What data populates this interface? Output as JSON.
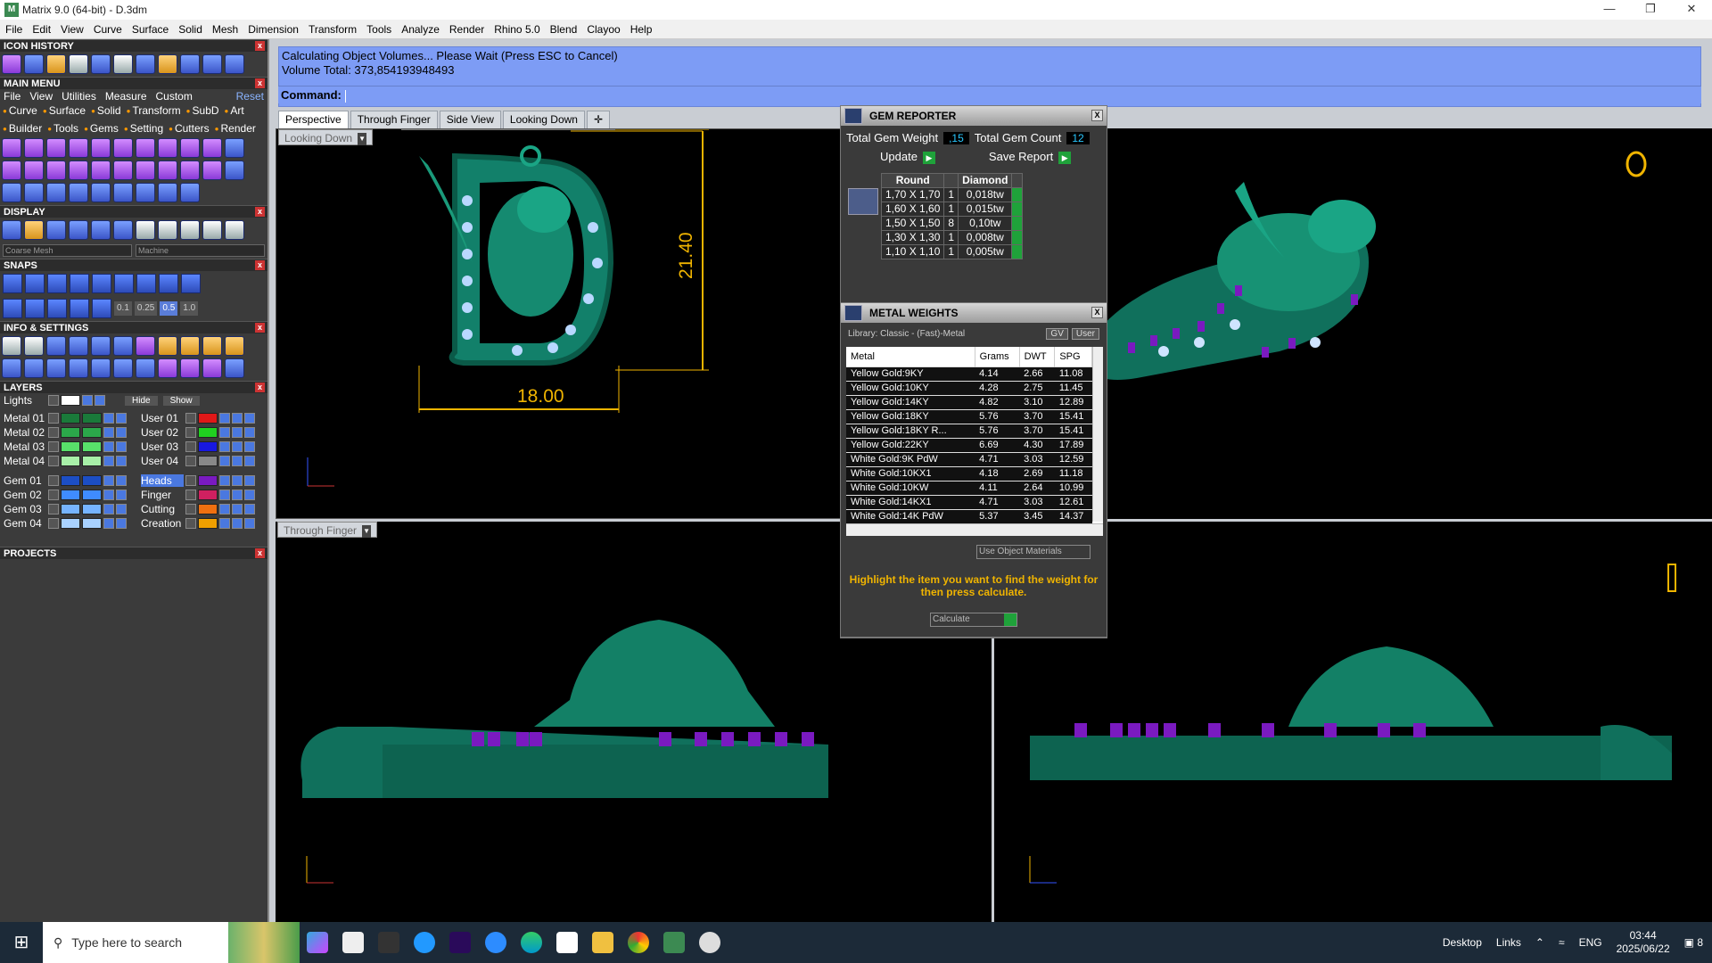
{
  "window": {
    "title": "Matrix 9.0 (64-bit) - D.3dm"
  },
  "menubar": [
    "File",
    "Edit",
    "View",
    "Curve",
    "Surface",
    "Solid",
    "Mesh",
    "Dimension",
    "Transform",
    "Tools",
    "Analyze",
    "Render",
    "Rhino 5.0",
    "Blend",
    "Clayoo",
    "Help"
  ],
  "left_panel": {
    "icon_history": "ICON HISTORY",
    "main_menu": "MAIN MENU",
    "main_menu_items": [
      "File",
      "View",
      "Utilities",
      "Measure",
      "Custom"
    ],
    "reset": "Reset",
    "categories": [
      "Curve",
      "Surface",
      "Solid",
      "Transform",
      "SubD",
      "Art",
      "Builder",
      "Tools",
      "Gems",
      "Setting",
      "Cutters",
      "Render"
    ],
    "display": "DISPLAY",
    "mesh_select": "Coarse Mesh",
    "material_select": "Machine",
    "snaps": "SNAPS",
    "snap_values": [
      "0.1",
      "0.25",
      "0.5",
      "1.0"
    ],
    "info_settings": "INFO & SETTINGS",
    "layers": "LAYERS",
    "lights": "Lights",
    "hide": "Hide",
    "show": "Show",
    "layers_left": [
      {
        "name": "Metal 01",
        "color": "#1a7a3a"
      },
      {
        "name": "Metal 02",
        "color": "#2ba84a"
      },
      {
        "name": "Metal 03",
        "color": "#58e06a"
      },
      {
        "name": "Metal 04",
        "color": "#a8f0a8"
      },
      {
        "name": "Gem 01",
        "color": "#1c4ec4"
      },
      {
        "name": "Gem 02",
        "color": "#3f8cff"
      },
      {
        "name": "Gem 03",
        "color": "#76b4ff"
      },
      {
        "name": "Gem 04",
        "color": "#a9d2ff"
      }
    ],
    "layers_right": [
      {
        "name": "User 01",
        "color": "#e01818"
      },
      {
        "name": "User 02",
        "color": "#20d020"
      },
      {
        "name": "User 03",
        "color": "#1818e0"
      },
      {
        "name": "User 04",
        "color": "#888888"
      },
      {
        "name": "Heads",
        "color": "#7a1ac0"
      },
      {
        "name": "Finger",
        "color": "#d02060"
      },
      {
        "name": "Cutting",
        "color": "#f07010"
      },
      {
        "name": "Creation",
        "color": "#f0a000"
      }
    ],
    "projects": "PROJECTS"
  },
  "command": {
    "line1": "Calculating Object Volumes... Please Wait (Press ESC to Cancel)",
    "line2": "Volume Total: 373,854193948493",
    "prompt": "Command:"
  },
  "tabs": [
    "Perspective",
    "Through Finger",
    "Side View",
    "Looking Down"
  ],
  "viewports": {
    "top_left_label": "Looking Down",
    "bottom_left_label": "Through Finger",
    "dim_width": "18.00",
    "dim_height": "21.40"
  },
  "gem_reporter": {
    "title": "GEM REPORTER",
    "total_weight_label": "Total Gem Weight",
    "total_weight": ",15",
    "total_count_label": "Total Gem Count",
    "total_count": "12",
    "update": "Update",
    "save_report": "Save Report",
    "headers": [
      "Round",
      "",
      "Diamond"
    ],
    "rows": [
      [
        "1,70 X 1,70",
        "1",
        "0,018tw"
      ],
      [
        "1,60 X 1,60",
        "1",
        "0,015tw"
      ],
      [
        "1,50 X 1,50",
        "8",
        "0,10tw"
      ],
      [
        "1,30 X 1,30",
        "1",
        "0,008tw"
      ],
      [
        "1,10 X 1,10",
        "1",
        "0,005tw"
      ]
    ]
  },
  "metal_weights": {
    "title": "METAL WEIGHTS",
    "library": "Library: Classic - (Fast)-Metal",
    "gv": "GV",
    "user": "User",
    "headers": [
      "Metal",
      "Grams",
      "DWT",
      "SPG"
    ],
    "rows": [
      [
        "Yellow Gold:9KY",
        "4.14",
        "2.66",
        "11.08"
      ],
      [
        "Yellow Gold:10KY",
        "4.28",
        "2.75",
        "11.45"
      ],
      [
        "Yellow Gold:14KY",
        "4.82",
        "3.10",
        "12.89"
      ],
      [
        "Yellow Gold:18KY",
        "5.76",
        "3.70",
        "15.41"
      ],
      [
        "Yellow Gold:18KY R...",
        "5.76",
        "3.70",
        "15.41"
      ],
      [
        "Yellow Gold:22KY",
        "6.69",
        "4.30",
        "17.89"
      ],
      [
        "White Gold:9K PdW",
        "4.71",
        "3.03",
        "12.59"
      ],
      [
        "White Gold:10KX1",
        "4.18",
        "2.69",
        "11.18"
      ],
      [
        "White Gold:10KW",
        "4.11",
        "2.64",
        "10.99"
      ],
      [
        "White Gold:14KX1",
        "4.71",
        "3.03",
        "12.61"
      ],
      [
        "White Gold:14K PdW",
        "5.37",
        "3.45",
        "14.37"
      ]
    ],
    "use_object_materials": "Use Object Materials",
    "hint": "Highlight the item you want to find the weight for then press calculate.",
    "calculate": "Calculate"
  },
  "taskbar": {
    "search_placeholder": "Type here to search",
    "desktop": "Desktop",
    "links": "Links",
    "lang": "ENG",
    "time": "03:44",
    "date": "2025/06/22",
    "notifications": "8"
  }
}
